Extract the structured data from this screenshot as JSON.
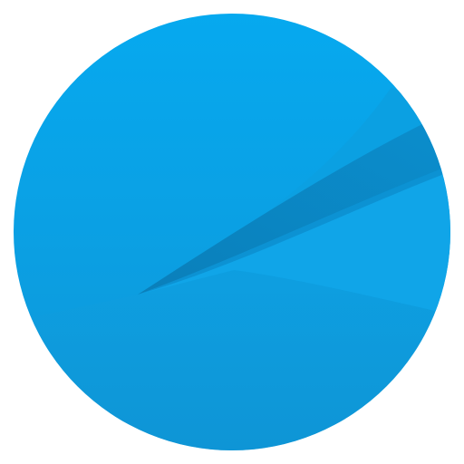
{
  "icon": {
    "name": "blue-circle-feather-app-icon",
    "colors": {
      "background": "#ffffff",
      "circle_top": "#06a9ef",
      "circle_bottom": "#0f97d8",
      "feather_dark": "#0a86c4",
      "feather_mid": "#0c93d4",
      "feather_light": "#12a6e8",
      "shadow": "#0b8bc9"
    }
  }
}
